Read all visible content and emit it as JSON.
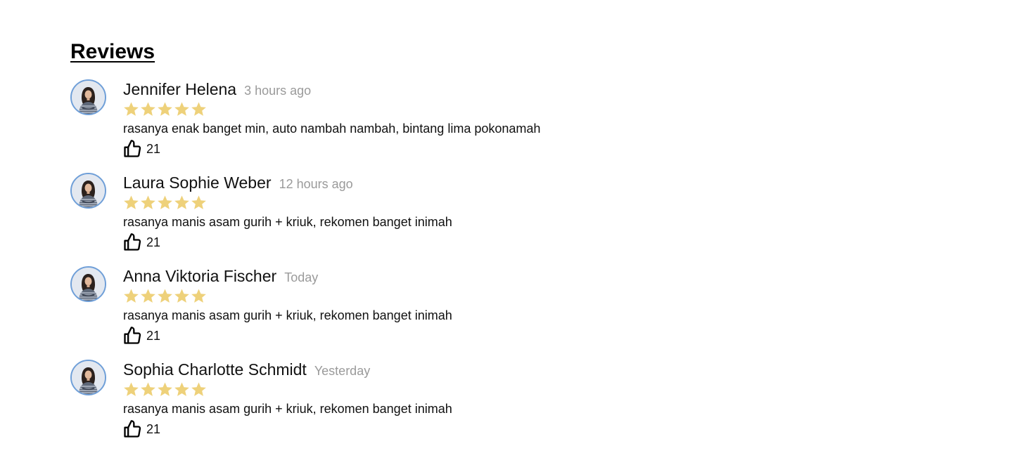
{
  "reviews_section": {
    "title": "Reviews",
    "star_color": "#eed17a",
    "reviews": [
      {
        "name": "Jennifer Helena",
        "time": "3 hours ago",
        "rating": 5,
        "max_rating": 5,
        "text": "rasanya enak banget min, auto nambah nambah, bintang lima pokonamah",
        "likes": "21",
        "avatar_icon": "user-avatar-photo",
        "like_icon": "thumbs-up-icon"
      },
      {
        "name": "Laura Sophie Weber",
        "time": "12 hours ago",
        "rating": 5,
        "max_rating": 5,
        "text": "rasanya manis asam gurih + kriuk, rekomen banget inimah",
        "likes": "21",
        "avatar_icon": "user-avatar-photo",
        "like_icon": "thumbs-up-icon"
      },
      {
        "name": "Anna Viktoria Fischer",
        "time": "Today",
        "rating": 5,
        "max_rating": 5,
        "text": "rasanya manis asam gurih + kriuk, rekomen banget inimah",
        "likes": "21",
        "avatar_icon": "user-avatar-photo",
        "like_icon": "thumbs-up-icon"
      },
      {
        "name": "Sophia Charlotte Schmidt",
        "time": "Yesterday",
        "rating": 5,
        "max_rating": 5,
        "text": "rasanya manis asam gurih + kriuk, rekomen banget inimah",
        "likes": "21",
        "avatar_icon": "user-avatar-photo",
        "like_icon": "thumbs-up-icon"
      }
    ]
  }
}
